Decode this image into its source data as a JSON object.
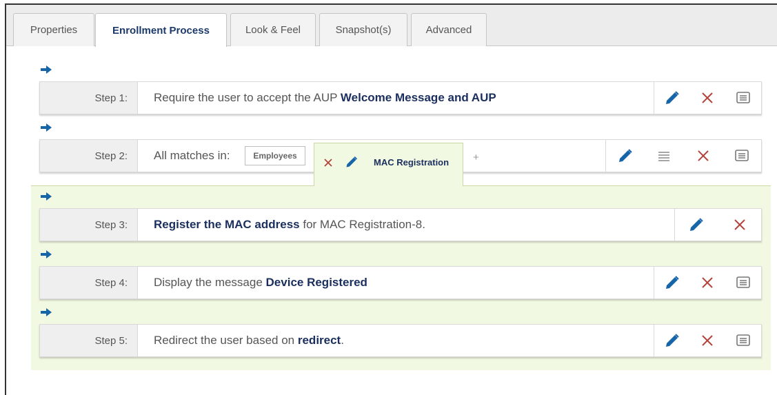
{
  "tabs": [
    {
      "label": "Properties",
      "active": false
    },
    {
      "label": "Enrollment Process",
      "active": true
    },
    {
      "label": "Look & Feel",
      "active": false
    },
    {
      "label": "Snapshot(s)",
      "active": false
    },
    {
      "label": "Advanced",
      "active": false
    }
  ],
  "steps": [
    {
      "num": "Step 1:",
      "prefix": "Require the user to accept the AUP ",
      "bold": "Welcome Message and AUP",
      "suffix": ""
    },
    {
      "num": "Step 2:",
      "prefix": "All matches in:",
      "bold": "",
      "suffix": ""
    },
    {
      "num": "Step 3:",
      "prefix": "",
      "bold": "Register the MAC address",
      "suffix": " for MAC Registration-8."
    },
    {
      "num": "Step 4:",
      "prefix": "Display the message ",
      "bold": "Device Registered",
      "suffix": ""
    },
    {
      "num": "Step 5:",
      "prefix": "Redirect the user based on ",
      "bold": "redirect",
      "suffix": "."
    }
  ],
  "branches": {
    "employees": "Employees",
    "mac_registration": "MAC Registration",
    "add": "+"
  },
  "colors": {
    "accent": "#1565a8",
    "delete": "#b5423b",
    "green_zone": "#f2f9e3"
  },
  "icons": [
    "arrow-right-icon",
    "pencil-icon",
    "close-icon",
    "message-icon",
    "reorder-icon"
  ]
}
